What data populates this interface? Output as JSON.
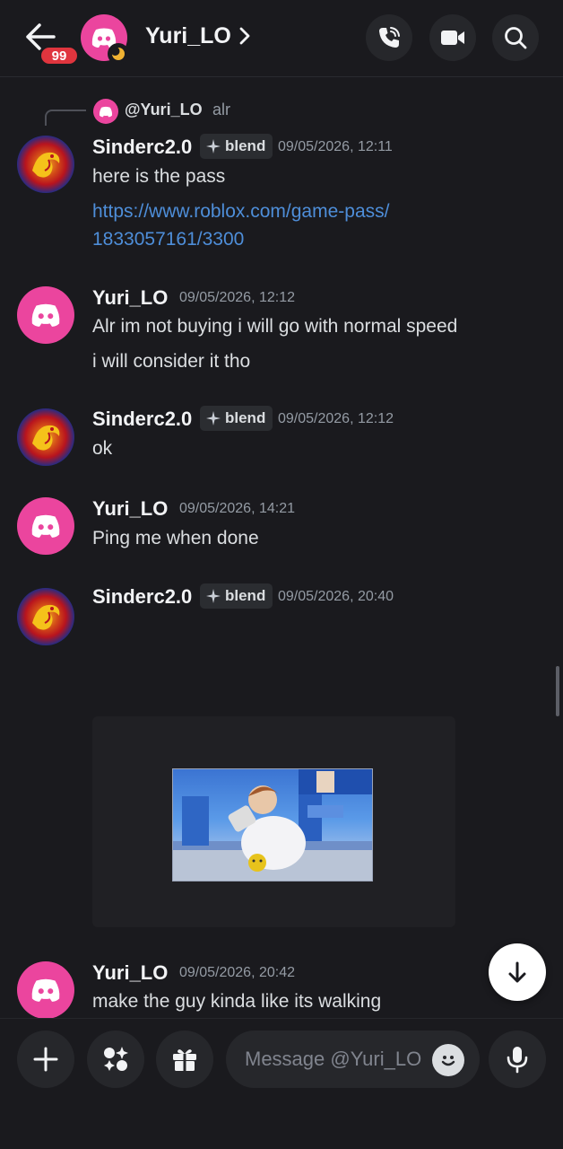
{
  "header": {
    "unread_badge": "99",
    "title": "Yuri_LO",
    "icons": [
      "back-arrow-icon",
      "phone-call-icon",
      "video-camera-icon",
      "search-icon"
    ]
  },
  "reply": {
    "username": "@Yuri_LO",
    "text": "alr"
  },
  "messages": [
    {
      "author": "Sinderc2.0",
      "tag": "blend",
      "timestamp": "09/05/2026, 12:11",
      "lines": [
        "here is the pass"
      ],
      "link_lines": [
        "https://www.roblox.com/game-pass/",
        "1833057161/3300"
      ]
    },
    {
      "author": "Yuri_LO",
      "timestamp": "09/05/2026, 12:12",
      "lines": [
        "Alr im not buying i will go with normal speed",
        "i will consider it tho"
      ]
    },
    {
      "author": "Sinderc2.0",
      "tag": "blend",
      "timestamp": "09/05/2026, 12:12",
      "lines": [
        "ok"
      ]
    },
    {
      "author": "Yuri_LO",
      "timestamp": "09/05/2026, 14:21",
      "lines": [
        "Ping me when done"
      ]
    },
    {
      "author": "Sinderc2.0",
      "tag": "blend",
      "timestamp": "09/05/2026, 20:40",
      "lines": []
    },
    {
      "author": "Yuri_LO",
      "timestamp": "09/05/2026, 20:42",
      "lines": [
        "make the guy kinda like its walking"
      ]
    }
  ],
  "composer": {
    "placeholder": "Message @Yuri_LO"
  },
  "colors": {
    "background": "#1a1a1e",
    "accent_pink": "#eb459e",
    "link": "#4e8ed9",
    "badge_red": "#e0353e"
  }
}
